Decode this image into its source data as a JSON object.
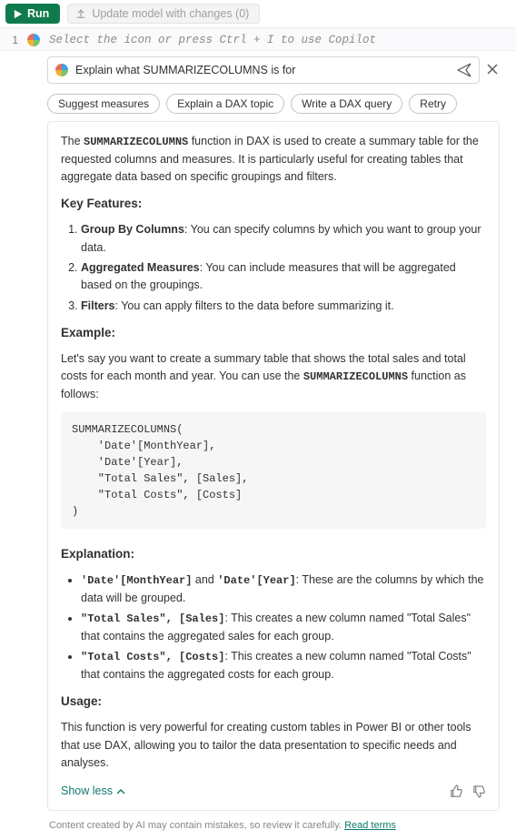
{
  "toolbar": {
    "run_label": "Run",
    "update_label": "Update model with changes (0)"
  },
  "editor": {
    "line": "1",
    "placeholder": "Select the icon or press Ctrl + I to use Copilot"
  },
  "copilot": {
    "input_value": "Explain what SUMMARIZECOLUMNS is for",
    "chips": [
      "Suggest measures",
      "Explain a DAX topic",
      "Write a DAX query",
      "Retry"
    ],
    "intro": {
      "pre": "The ",
      "fn": "SUMMARIZECOLUMNS",
      "post": " function in DAX is used to create a summary table for the requested columns and measures. It is particularly useful for creating tables that aggregate data based on specific groupings and filters."
    },
    "h_features": "Key Features:",
    "features": [
      {
        "b": "Group By Columns",
        "t": ": You can specify columns by which you want to group your data."
      },
      {
        "b": "Aggregated Measures",
        "t": ": You can include measures that will be aggregated based on the groupings."
      },
      {
        "b": "Filters",
        "t": ": You can apply filters to the data before summarizing it."
      }
    ],
    "h_example": "Example:",
    "example_intro": {
      "pre": "Let's say you want to create a summary table that shows the total sales and total costs for each month and year. You can use the ",
      "fn": "SUMMARIZECOLUMNS",
      "post": " function as follows:"
    },
    "code": "SUMMARIZECOLUMNS(\n    'Date'[MonthYear],\n    'Date'[Year],\n    \"Total Sales\", [Sales],\n    \"Total Costs\", [Costs]\n)",
    "h_explanation": "Explanation:",
    "explanations": [
      {
        "c1": "'Date'[MonthYear]",
        "mid": " and ",
        "c2": "'Date'[Year]",
        "t": ": These are the columns by which the data will be grouped."
      },
      {
        "c1": "\"Total Sales\", [Sales]",
        "mid": "",
        "c2": "",
        "t": ": This creates a new column named \"Total Sales\" that contains the aggregated sales for each group."
      },
      {
        "c1": "\"Total Costs\", [Costs]",
        "mid": "",
        "c2": "",
        "t": ": This creates a new column named \"Total Costs\" that contains the aggregated costs for each group."
      }
    ],
    "h_usage": "Usage:",
    "usage_text": "This function is very powerful for creating custom tables in Power BI or other tools that use DAX, allowing you to tailor the data presentation to specific needs and analyses.",
    "show_less": "Show less",
    "disclaimer_text": "Content created by AI may contain mistakes, so review it carefully. ",
    "disclaimer_link": "Read terms"
  }
}
